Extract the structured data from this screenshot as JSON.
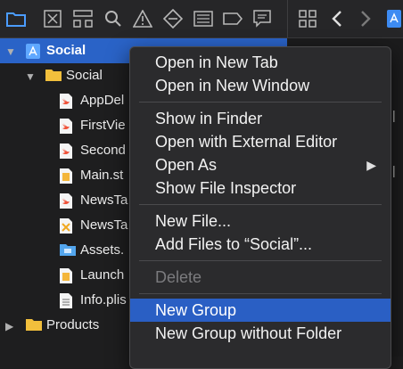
{
  "toolbar": {
    "icons": [
      "folder-icon",
      "source-control-icon",
      "hierarchy-icon",
      "search-icon",
      "warning-icon",
      "test-diamond-icon",
      "list-icon",
      "breakpoint-tag-icon",
      "comment-icon"
    ],
    "right_icons": [
      "grid-icon",
      "back-arrow-icon",
      "forward-arrow-icon",
      "file-icon"
    ]
  },
  "navigator": {
    "rows": [
      {
        "label": "Social",
        "icon": "xcode-project-icon",
        "indent": 0,
        "disclosure": "expanded",
        "selected": true
      },
      {
        "label": "Social",
        "icon": "folder-icon",
        "indent": 1,
        "disclosure": "expanded"
      },
      {
        "label": "AppDel",
        "icon": "swift-file-icon",
        "indent": 2
      },
      {
        "label": "FirstVie",
        "icon": "swift-file-icon",
        "indent": 2
      },
      {
        "label": "Second",
        "icon": "swift-file-icon",
        "indent": 2
      },
      {
        "label": "Main.st",
        "icon": "storyboard-icon",
        "indent": 2
      },
      {
        "label": "NewsTa",
        "icon": "swift-file-icon",
        "indent": 2
      },
      {
        "label": "NewsTa",
        "icon": "xib-icon",
        "indent": 2
      },
      {
        "label": "Assets.",
        "icon": "asset-catalog-icon",
        "indent": 2
      },
      {
        "label": "Launch",
        "icon": "storyboard-icon",
        "indent": 2
      },
      {
        "label": "Info.plis",
        "icon": "plist-icon",
        "indent": 2
      },
      {
        "label": "Products",
        "icon": "folder-icon",
        "indent": 0,
        "disclosure": "collapsed"
      }
    ]
  },
  "context_menu": {
    "items": [
      {
        "label": "Open in New Tab"
      },
      {
        "label": "Open in New Window"
      },
      {
        "separator": true
      },
      {
        "label": "Show in Finder"
      },
      {
        "label": "Open with External Editor"
      },
      {
        "label": "Open As",
        "submenu": true
      },
      {
        "label": "Show File Inspector"
      },
      {
        "separator": true
      },
      {
        "label": "New File..."
      },
      {
        "label": "Add Files to “Social”..."
      },
      {
        "separator": true
      },
      {
        "label": "Delete",
        "disabled": true
      },
      {
        "separator": true
      },
      {
        "label": "New Group",
        "highlighted": true
      },
      {
        "label": "New Group without Folder"
      }
    ]
  },
  "colors": {
    "selection": "#2a63c7",
    "menu_highlight": "#2a5fc4",
    "menu_bg": "#2b2b2d"
  }
}
